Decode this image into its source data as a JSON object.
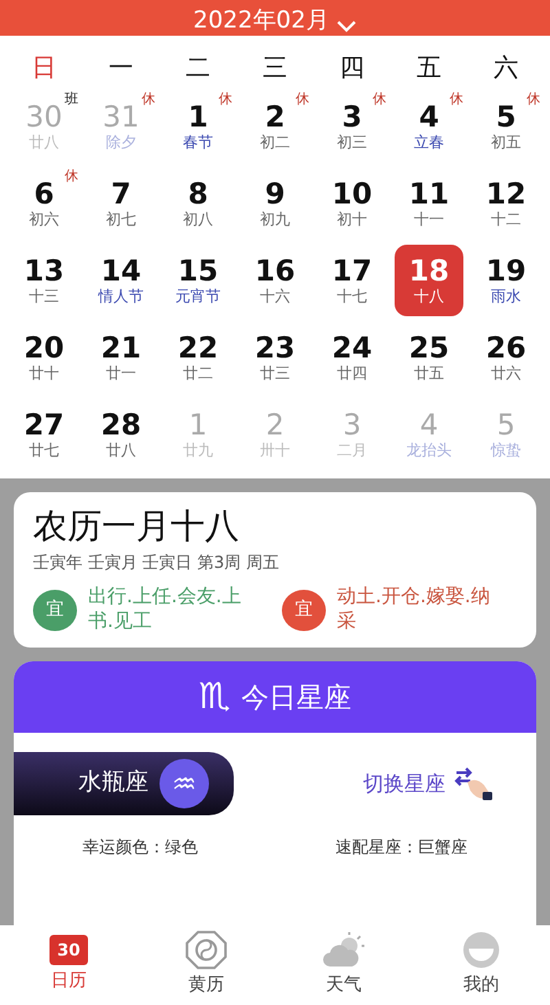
{
  "header": {
    "title": "2022年02月"
  },
  "weekdays": [
    {
      "label": "日",
      "weekend": true
    },
    {
      "label": "一",
      "weekend": false
    },
    {
      "label": "二",
      "weekend": false
    },
    {
      "label": "三",
      "weekend": false
    },
    {
      "label": "四",
      "weekend": false
    },
    {
      "label": "五",
      "weekend": false
    },
    {
      "label": "六",
      "weekend": false
    }
  ],
  "days": [
    {
      "day": "30",
      "lunar": "廿八",
      "muted": true,
      "festival": false,
      "badge": "班",
      "kind": "work",
      "selected": false
    },
    {
      "day": "31",
      "lunar": "除夕",
      "muted": true,
      "festival": true,
      "badge": "休",
      "kind": "rest",
      "selected": false
    },
    {
      "day": "1",
      "lunar": "春节",
      "muted": false,
      "festival": true,
      "badge": "休",
      "kind": "rest",
      "selected": false
    },
    {
      "day": "2",
      "lunar": "初二",
      "muted": false,
      "festival": false,
      "badge": "休",
      "kind": "rest",
      "selected": false
    },
    {
      "day": "3",
      "lunar": "初三",
      "muted": false,
      "festival": false,
      "badge": "休",
      "kind": "rest",
      "selected": false
    },
    {
      "day": "4",
      "lunar": "立春",
      "muted": false,
      "festival": true,
      "badge": "休",
      "kind": "rest",
      "selected": false
    },
    {
      "day": "5",
      "lunar": "初五",
      "muted": false,
      "festival": false,
      "badge": "休",
      "kind": "rest",
      "selected": false
    },
    {
      "day": "6",
      "lunar": "初六",
      "muted": false,
      "festival": false,
      "badge": "休",
      "kind": "rest",
      "selected": false
    },
    {
      "day": "7",
      "lunar": "初七",
      "muted": false,
      "festival": false,
      "selected": false
    },
    {
      "day": "8",
      "lunar": "初八",
      "muted": false,
      "festival": false,
      "selected": false
    },
    {
      "day": "9",
      "lunar": "初九",
      "muted": false,
      "festival": false,
      "selected": false
    },
    {
      "day": "10",
      "lunar": "初十",
      "muted": false,
      "festival": false,
      "selected": false
    },
    {
      "day": "11",
      "lunar": "十一",
      "muted": false,
      "festival": false,
      "selected": false
    },
    {
      "day": "12",
      "lunar": "十二",
      "muted": false,
      "festival": false,
      "selected": false
    },
    {
      "day": "13",
      "lunar": "十三",
      "muted": false,
      "festival": false,
      "selected": false
    },
    {
      "day": "14",
      "lunar": "情人节",
      "muted": false,
      "festival": true,
      "selected": false
    },
    {
      "day": "15",
      "lunar": "元宵节",
      "muted": false,
      "festival": true,
      "selected": false
    },
    {
      "day": "16",
      "lunar": "十六",
      "muted": false,
      "festival": false,
      "selected": false
    },
    {
      "day": "17",
      "lunar": "十七",
      "muted": false,
      "festival": false,
      "selected": false
    },
    {
      "day": "18",
      "lunar": "十八",
      "muted": false,
      "festival": false,
      "selected": true
    },
    {
      "day": "19",
      "lunar": "雨水",
      "muted": false,
      "festival": true,
      "selected": false
    },
    {
      "day": "20",
      "lunar": "廿十",
      "muted": false,
      "festival": false,
      "selected": false
    },
    {
      "day": "21",
      "lunar": "廿一",
      "muted": false,
      "festival": false,
      "selected": false
    },
    {
      "day": "22",
      "lunar": "廿二",
      "muted": false,
      "festival": false,
      "selected": false
    },
    {
      "day": "23",
      "lunar": "廿三",
      "muted": false,
      "festival": false,
      "selected": false
    },
    {
      "day": "24",
      "lunar": "廿四",
      "muted": false,
      "festival": false,
      "selected": false
    },
    {
      "day": "25",
      "lunar": "廿五",
      "muted": false,
      "festival": false,
      "selected": false
    },
    {
      "day": "26",
      "lunar": "廿六",
      "muted": false,
      "festival": false,
      "selected": false
    },
    {
      "day": "27",
      "lunar": "廿七",
      "muted": false,
      "festival": false,
      "selected": false
    },
    {
      "day": "28",
      "lunar": "廿八",
      "muted": false,
      "festival": false,
      "selected": false
    },
    {
      "day": "1",
      "lunar": "廿九",
      "muted": true,
      "festival": false,
      "selected": false
    },
    {
      "day": "2",
      "lunar": "卅十",
      "muted": true,
      "festival": false,
      "selected": false
    },
    {
      "day": "3",
      "lunar": "二月",
      "muted": true,
      "festival": false,
      "selected": false
    },
    {
      "day": "4",
      "lunar": "龙抬头",
      "muted": true,
      "festival": true,
      "selected": false
    },
    {
      "day": "5",
      "lunar": "惊蛰",
      "muted": true,
      "festival": true,
      "selected": false
    }
  ],
  "lunar_card": {
    "title": "农历一月十八",
    "subtitle": "壬寅年 壬寅月 壬寅日  第3周 周五",
    "items": [
      {
        "kind": "good",
        "badge": "宜",
        "text": "出行.上任.会友.上书.见工"
      },
      {
        "kind": "bad",
        "badge": "宜",
        "text": "动土.开仓.嫁娶.纳采"
      }
    ]
  },
  "zodiac_card": {
    "symbol": "♏",
    "title": "今日星座",
    "sign": "水瓶座",
    "sign_symbol": "♒",
    "switch_label": "切换星座",
    "facts": [
      "幸运颜色：绿色",
      "速配星座：巨蟹座"
    ]
  },
  "tabs": [
    {
      "label": "日历",
      "kind": "calendar",
      "icon_text": "30",
      "selected": true
    },
    {
      "label": "黄历",
      "kind": "almanac",
      "selected": false
    },
    {
      "label": "天气",
      "kind": "weather",
      "selected": false
    },
    {
      "label": "我的",
      "kind": "profile",
      "selected": false
    }
  ]
}
